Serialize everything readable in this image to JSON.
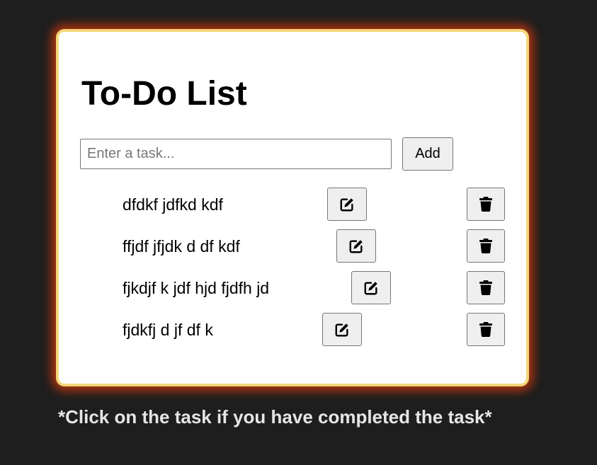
{
  "app": {
    "title": "To-Do List"
  },
  "input": {
    "placeholder": "Enter a task...",
    "value": ""
  },
  "buttons": {
    "add_label": "Add"
  },
  "tasks": [
    {
      "text": "dfdkf jdfkd kdf",
      "completed": false
    },
    {
      "text": "ffjdf jfjdk d df kdf",
      "completed": false
    },
    {
      "text": "fjkdjf k jdf hjd fjdfh jd",
      "completed": false
    },
    {
      "text": "fjdkfj d jf df k",
      "completed": false
    }
  ],
  "icons": {
    "edit": "edit-icon",
    "delete": "trash-icon"
  },
  "colors": {
    "page_background": "#1e1e1e",
    "card_background": "#ffffff",
    "card_border": "#f3d779",
    "card_glow": "#e63c0a",
    "button_background": "#efefef",
    "footer_text": "#e6e6e6"
  },
  "footer": {
    "note": "*Click on the task if you have completed the task*"
  }
}
